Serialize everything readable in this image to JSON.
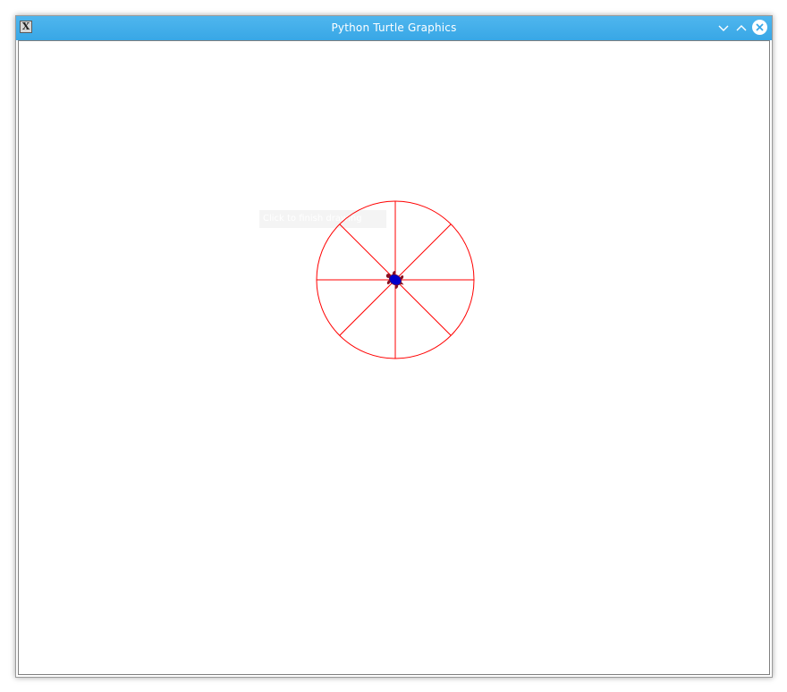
{
  "window": {
    "title": "Python Turtle Graphics",
    "app_icon": "x-window-icon",
    "title_bar_color": "#3aa8e7",
    "controls": {
      "minimize_icon": "chevron-down-icon",
      "maximize_icon": "chevron-up-icon",
      "close_icon": "close-circle-icon"
    }
  },
  "canvas": {
    "background": "#ffffff",
    "drawing": {
      "shape": "circle-with-8-spokes",
      "spoke_count": 8,
      "pen_color": "#ff0000",
      "turtle_color": "#0000cc",
      "turtle_shape": "turtle-icon"
    },
    "tooltip": {
      "text": "Click to finish drawing"
    }
  }
}
